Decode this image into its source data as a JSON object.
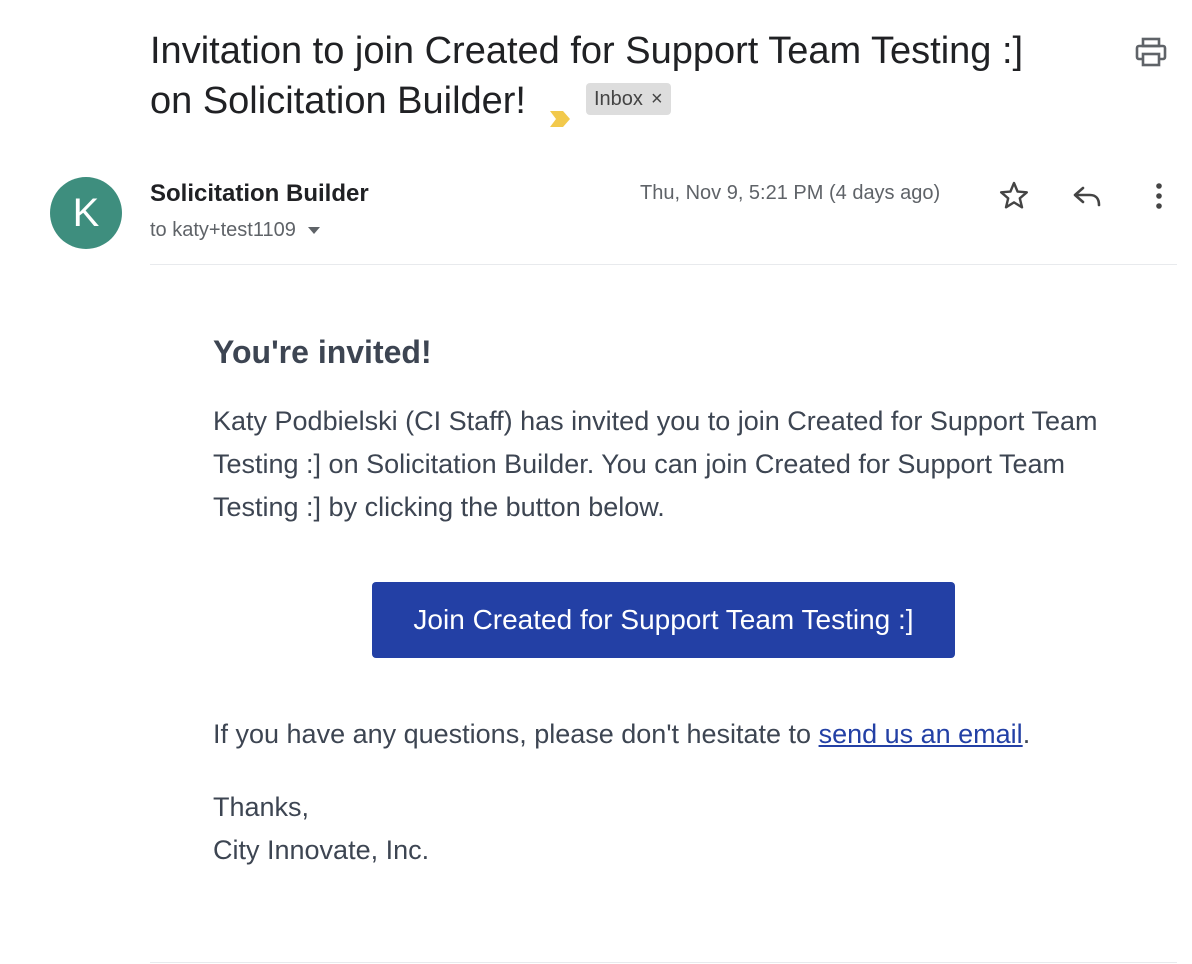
{
  "email": {
    "subject_line1": "Invitation to join Created for Support Team Testing :]",
    "subject_line2": "on Solicitation Builder!",
    "label": "Inbox",
    "label_remove": "×",
    "importance_color": "#f2c94c"
  },
  "sender": {
    "avatar_initial": "K",
    "avatar_color": "#3e8e7e",
    "name": "Solicitation Builder",
    "recipient": "to katy+test1109",
    "date": "Thu, Nov 9, 5:21 PM (4 days ago)"
  },
  "header_icons": [
    "print-icon",
    "star-icon",
    "reply-icon",
    "more-vert-icon"
  ],
  "message": {
    "heading": "You're invited!",
    "paragraph": "Katy Podbielski (CI Staff) has invited you to join Created for Support Team Testing :] on Solicitation Builder. You can join Created for Support Team Testing :] by clicking the button below.",
    "button_label": "Join Created for Support Team Testing :]",
    "button_color": "#2340a5",
    "questions_prefix": "If you have any questions, please don't hesitate to ",
    "questions_link": "send us an email",
    "questions_suffix": ".",
    "thanks": "Thanks,",
    "company": "City Innovate, Inc."
  }
}
